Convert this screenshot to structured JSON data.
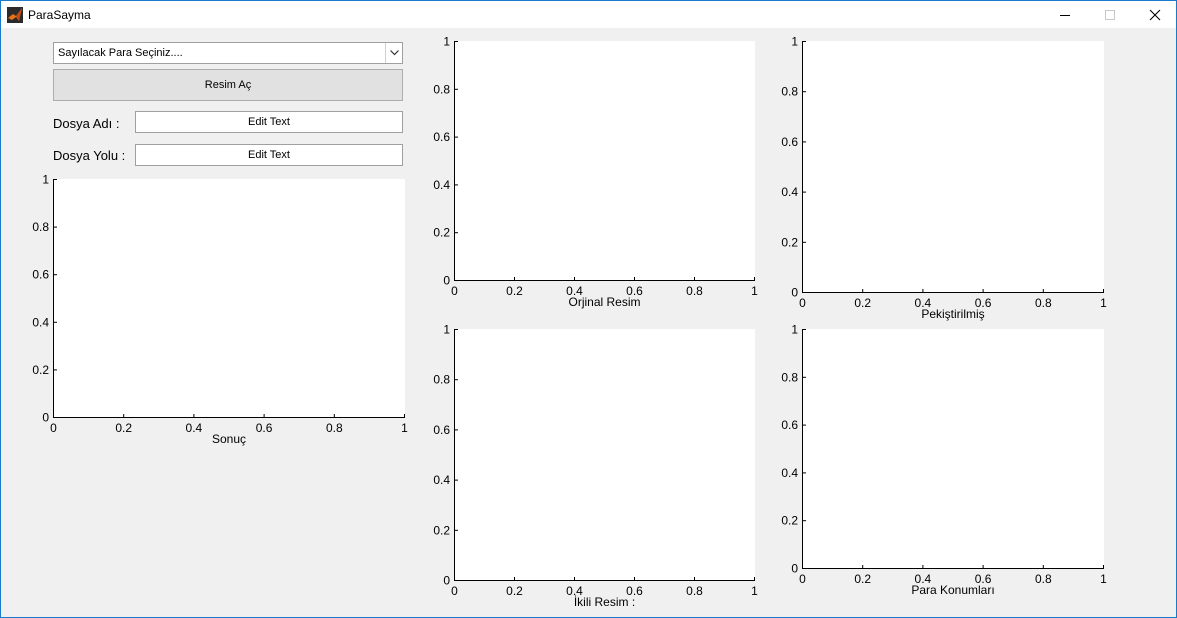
{
  "window": {
    "title": "ParaSayma"
  },
  "controls": {
    "popup_value": "Sayılacak Para Seçiniz....",
    "open_button": "Resim Aç",
    "file_name_label": "Dosya Adı :",
    "file_name_value": "Edit Text",
    "file_path_label": "Dosya Yolu :",
    "file_path_value": "Edit Text"
  },
  "chart_data": [
    {
      "type": "scatter",
      "name": "sonuc",
      "xlabel": "Sonuç",
      "xlim": [
        0,
        1
      ],
      "ylim": [
        0,
        1
      ],
      "xticks": [
        "0",
        "0.2",
        "0.4",
        "0.6",
        "0.8",
        "1"
      ],
      "yticks": [
        "0",
        "0.2",
        "0.4",
        "0.6",
        "0.8",
        "1"
      ]
    },
    {
      "type": "scatter",
      "name": "orjinal",
      "xlabel": "Orjinal Resim",
      "xlim": [
        0,
        1
      ],
      "ylim": [
        0,
        1
      ],
      "xticks": [
        "0",
        "0.2",
        "0.4",
        "0.6",
        "0.8",
        "1"
      ],
      "yticks": [
        "0",
        "0.2",
        "0.4",
        "0.6",
        "0.8",
        "1"
      ]
    },
    {
      "type": "scatter",
      "name": "pekistirilmis",
      "xlabel": "Pekiştirilmiş",
      "xlim": [
        0,
        1
      ],
      "ylim": [
        0,
        1
      ],
      "xticks": [
        "0",
        "0.2",
        "0.4",
        "0.6",
        "0.8",
        "1"
      ],
      "yticks": [
        "0",
        "0.2",
        "0.4",
        "0.6",
        "0.8",
        "1"
      ]
    },
    {
      "type": "scatter",
      "name": "ikili",
      "xlabel": "İkili Resim :",
      "xlim": [
        0,
        1
      ],
      "ylim": [
        0,
        1
      ],
      "xticks": [
        "0",
        "0.2",
        "0.4",
        "0.6",
        "0.8",
        "1"
      ],
      "yticks": [
        "0",
        "0.2",
        "0.4",
        "0.6",
        "0.8",
        "1"
      ]
    },
    {
      "type": "scatter",
      "name": "konumlar",
      "xlabel": "Para Konumları",
      "xlim": [
        0,
        1
      ],
      "ylim": [
        0,
        1
      ],
      "xticks": [
        "0",
        "0.2",
        "0.4",
        "0.6",
        "0.8",
        "1"
      ],
      "yticks": [
        "0",
        "0.2",
        "0.4",
        "0.6",
        "0.8",
        "1"
      ]
    }
  ]
}
